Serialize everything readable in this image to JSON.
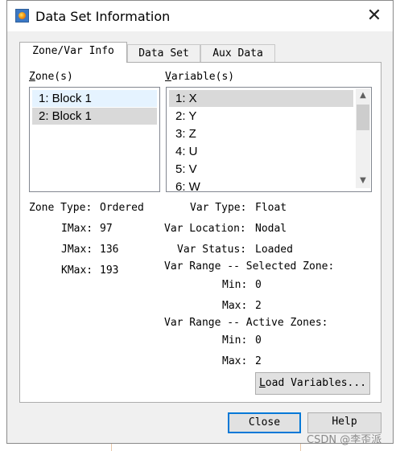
{
  "window": {
    "title": "Data Set Information",
    "close_glyph": "✕"
  },
  "tabs": [
    {
      "label": "Zone/Var Info",
      "active": true
    },
    {
      "label": "Data Set",
      "active": false
    },
    {
      "label": "Aux Data",
      "active": false
    }
  ],
  "zones": {
    "label": "Zone(s)",
    "items": [
      "1: Block 1",
      "2: Block 1"
    ]
  },
  "variables": {
    "label": "Variable(s)",
    "items": [
      "1: X",
      "2: Y",
      "3: Z",
      "4: U",
      "5: V",
      "6: W"
    ],
    "scroll_up_icon": "chevron-up-icon",
    "scroll_down_icon": "chevron-down-icon"
  },
  "zone_info": {
    "zone_type_label": "Zone Type:",
    "zone_type": "Ordered",
    "imax_label": "IMax:",
    "imax": "97",
    "jmax_label": "JMax:",
    "jmax": "136",
    "kmax_label": "KMax:",
    "kmax": "193"
  },
  "var_info": {
    "var_type_label": "Var Type:",
    "var_type": "Float",
    "var_location_label": "Var Location:",
    "var_location": "Nodal",
    "var_status_label": "Var Status:",
    "var_status": "Loaded",
    "selected_range_label": "Var Range -- Selected Zone:",
    "selected_min_label": "Min:",
    "selected_min": "0",
    "selected_max_label": "Max:",
    "selected_max": "2",
    "active_range_label": "Var Range -- Active Zones:",
    "active_min_label": "Min:",
    "active_min": "0",
    "active_max_label": "Max:",
    "active_max": "2"
  },
  "buttons": {
    "load_variables": "Load Variables...",
    "close": "Close",
    "help": "Help"
  },
  "watermark": "CSDN @李歪派",
  "colors": {
    "accent": "#0078d7",
    "list_selected": "#d9d9d9",
    "list_selected_focus": "#e5f3ff"
  }
}
